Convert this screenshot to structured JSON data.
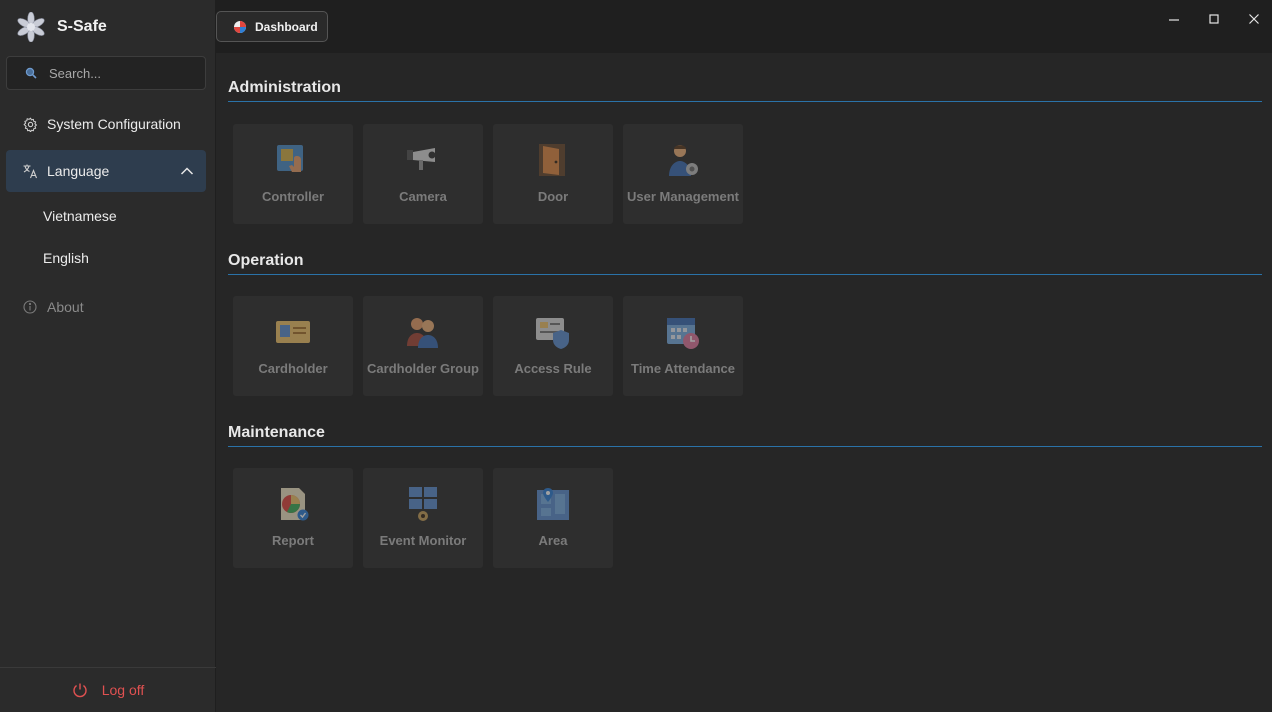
{
  "app": {
    "name": "S-Safe"
  },
  "search": {
    "placeholder": "Search..."
  },
  "sidebar": {
    "items": [
      {
        "label": "System Configuration",
        "icon": "gear-icon"
      },
      {
        "label": "Language",
        "icon": "language-icon",
        "expanded": true
      },
      {
        "label": "About",
        "icon": "info-icon",
        "disabled": true
      }
    ],
    "language_options": [
      "Vietnamese",
      "English"
    ],
    "logoff_label": "Log off"
  },
  "tab": {
    "label": "Dashboard"
  },
  "window_controls": [
    "minimize-icon",
    "maximize-icon",
    "close-icon"
  ],
  "sections": [
    {
      "title": "Administration",
      "tiles": [
        {
          "label": "Controller",
          "icon": "controller-icon"
        },
        {
          "label": "Camera",
          "icon": "camera-icon"
        },
        {
          "label": "Door",
          "icon": "door-icon"
        },
        {
          "label": "User Management",
          "icon": "user-management-icon"
        }
      ]
    },
    {
      "title": "Operation",
      "tiles": [
        {
          "label": "Cardholder",
          "icon": "cardholder-icon"
        },
        {
          "label": "Cardholder Group",
          "icon": "cardholder-group-icon"
        },
        {
          "label": "Access Rule",
          "icon": "access-rule-icon"
        },
        {
          "label": "Time Attendance",
          "icon": "time-attendance-icon"
        }
      ]
    },
    {
      "title": "Maintenance",
      "tiles": [
        {
          "label": "Report",
          "icon": "report-icon"
        },
        {
          "label": "Event Monitor",
          "icon": "event-monitor-icon"
        },
        {
          "label": "Area",
          "icon": "area-icon"
        }
      ]
    }
  ],
  "colors": {
    "accent_line": "#2a72a8",
    "logoff": "#e05151",
    "active_nav": "#2e3d4e"
  }
}
